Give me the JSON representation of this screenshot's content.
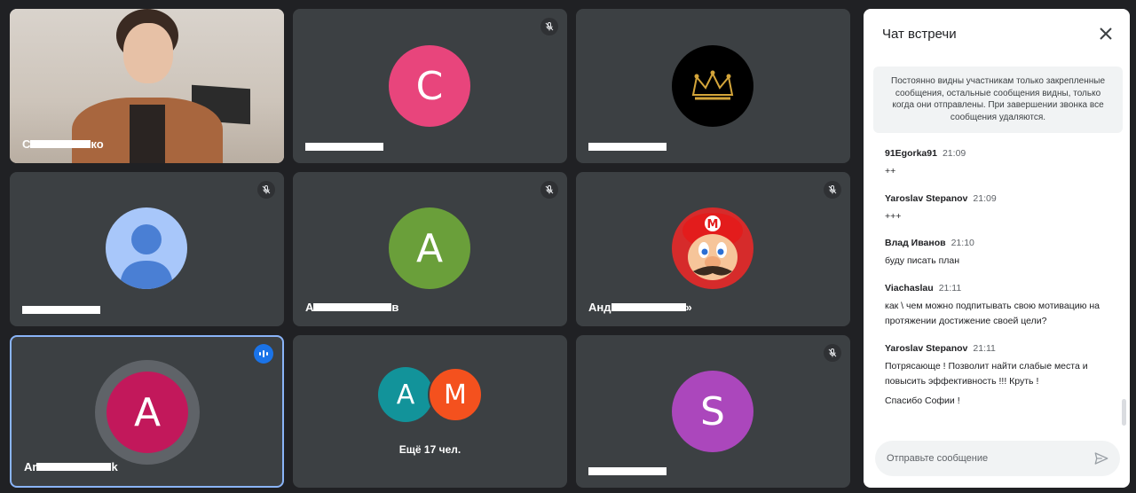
{
  "tiles": [
    {
      "name_prefix": "С",
      "name_suffix": "ко"
    },
    {
      "avatar_letter": "C",
      "avatar_color": "#e8457c"
    },
    {},
    {},
    {
      "avatar_letter": "A",
      "avatar_color": "#6a9f3a",
      "name_prefix": "А",
      "name_suffix": "в"
    },
    {
      "name_prefix": "Анд",
      "name_suffix": "»"
    },
    {
      "avatar_letter": "A",
      "avatar_color": "#c2185b",
      "name_prefix": "Ar",
      "name_suffix": "k",
      "speaking": true
    },
    {
      "avatar_letter_1": "A",
      "avatar_color_1": "#12939a",
      "avatar_letter_2": "M",
      "avatar_color_2": "#f4511e",
      "more_label": "Ещё 17 чел."
    },
    {
      "avatar_letter": "S",
      "avatar_color": "#ab47bc"
    }
  ],
  "chat": {
    "title": "Чат встречи",
    "notice": "Постоянно видны участникам только закрепленные сообщения, остальные сообщения видны, только когда они отправлены. При завершении звонка все сообщения удаляются.",
    "messages": [
      {
        "author": "91Egorka91",
        "time": "21:09",
        "lines": [
          "++"
        ]
      },
      {
        "author": "Yaroslav Stepanov",
        "time": "21:09",
        "lines": [
          "+++"
        ]
      },
      {
        "author": "Влад Иванов",
        "time": "21:10",
        "lines": [
          "буду писать план"
        ]
      },
      {
        "author": "Viachaslau",
        "time": "21:11",
        "lines": [
          "как \\ чем можно подпитывать свою мотивацию на протяжении достижение своей цели?"
        ]
      },
      {
        "author": "Yaroslav Stepanov",
        "time": "21:11",
        "lines": [
          "Потрясающе ! Позволит найти слабые места и повысить эффективность !!! Круть !",
          "Спасибо Софии !"
        ]
      }
    ],
    "input_placeholder": "Отправьте сообщение"
  },
  "icons": {
    "mic_off": "mic-off-icon",
    "speaking": "audio-level-icon",
    "close": "close-icon",
    "send": "send-icon",
    "default_avatar": "person-icon",
    "crown": "crown-icon",
    "mario": "mario-avatar"
  },
  "colors": {
    "background": "#202124",
    "tile": "#3c4043",
    "active_border": "#8ab4f8",
    "speaking_badge": "#1a73e8"
  }
}
